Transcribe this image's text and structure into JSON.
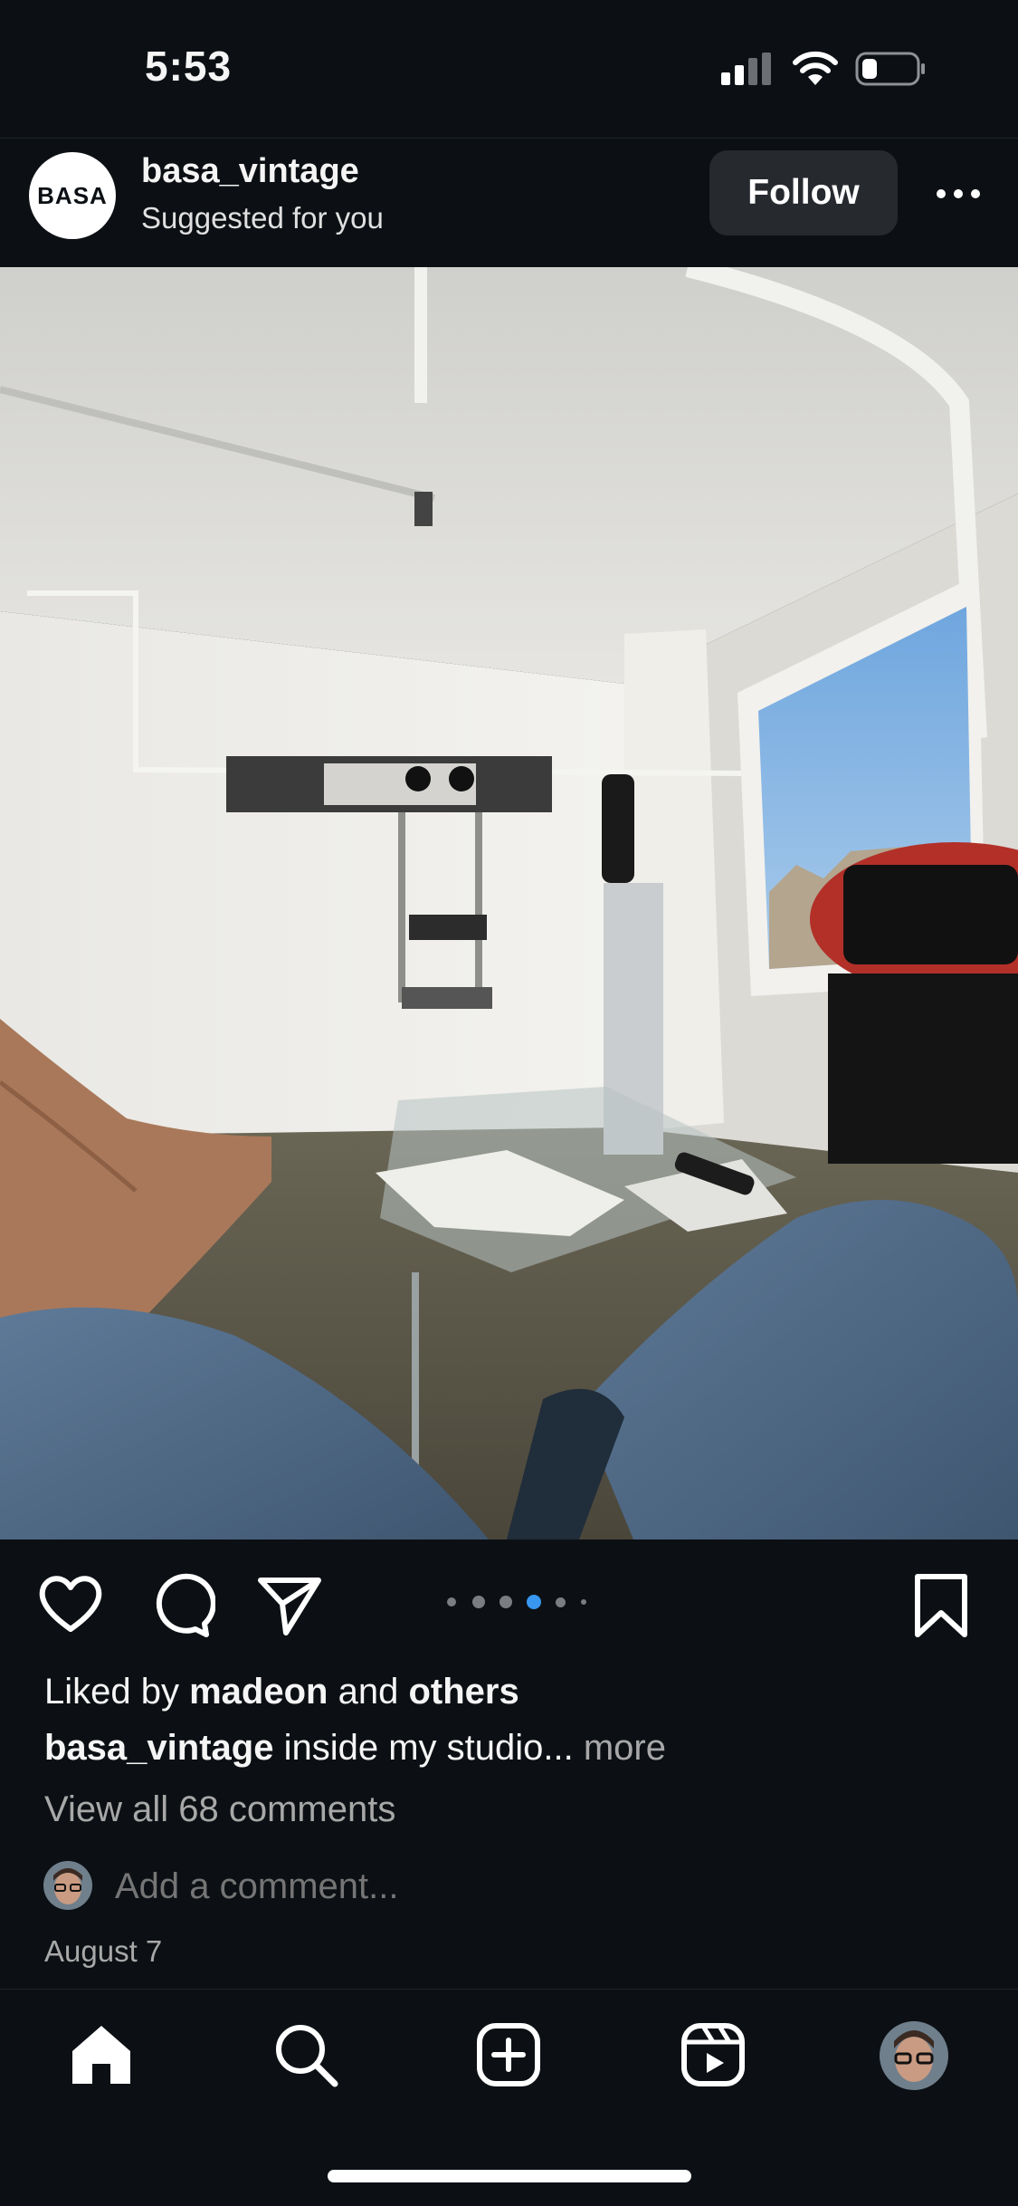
{
  "status_bar": {
    "time": "5:53",
    "signal_icon": "cellular-signal-icon",
    "wifi_icon": "wifi-icon",
    "battery_icon": "battery-low-icon"
  },
  "header": {
    "avatar_text": "BASA",
    "username": "basa_vintage",
    "subtitle": "Suggested for you",
    "follow_label": "Follow",
    "more_icon": "more-horizontal-icon"
  },
  "post": {
    "image_icon": "studio-room-photo",
    "carousel": {
      "count": 6,
      "active_index": 3
    }
  },
  "actions": {
    "like_icon": "heart-icon",
    "comment_icon": "comment-icon",
    "share_icon": "paper-plane-icon",
    "save_icon": "bookmark-icon"
  },
  "likes": {
    "prefix": "Liked by ",
    "user": "madeon",
    "middle": " and ",
    "others": "others"
  },
  "caption": {
    "user": "basa_vintage",
    "text": " inside my studio... ",
    "more": "more"
  },
  "comments": {
    "view_all": "View all 68 comments",
    "placeholder": "Add a comment..."
  },
  "date": "August 7",
  "bottom_nav": {
    "home_icon": "home-icon",
    "search_icon": "search-icon",
    "create_icon": "plus-square-icon",
    "reels_icon": "reels-icon",
    "profile_icon": "profile-avatar"
  },
  "colors": {
    "background": "#0c1014",
    "follow_button": "#262a2f",
    "active_dot": "#3897f0",
    "secondary_text": "#a8a8a8"
  }
}
